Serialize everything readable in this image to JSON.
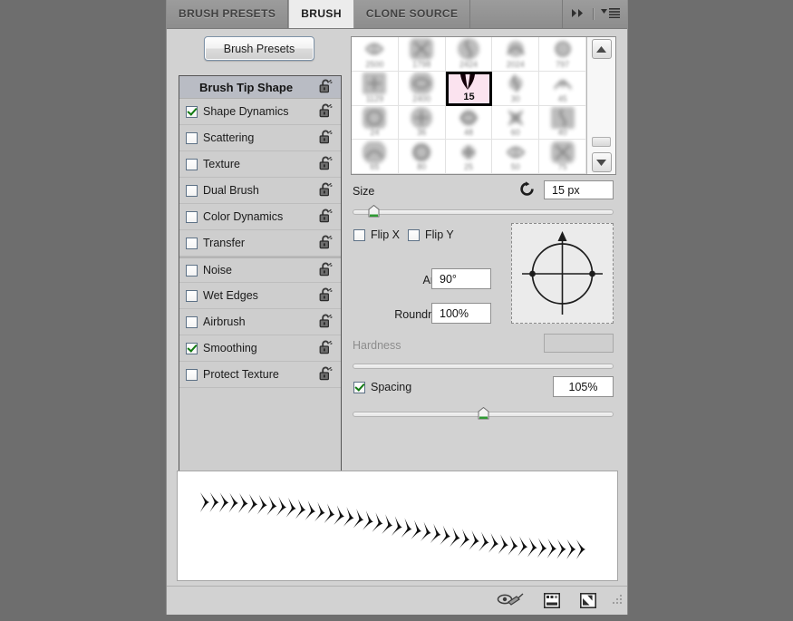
{
  "panel": {
    "title": "Brush",
    "tabs": [
      {
        "label": "BRUSH PRESETS",
        "active": false
      },
      {
        "label": "BRUSH",
        "active": true
      },
      {
        "label": "CLONE SOURCE",
        "active": false
      }
    ],
    "expand_icon": "double-chevron-right-icon",
    "menu_icon": "panel-menu-icon"
  },
  "presets_button": {
    "label": "Brush Presets"
  },
  "options": {
    "header": {
      "label": "Brush Tip Shape",
      "lock_icon": "unlocked-padlock-icon"
    },
    "items": [
      {
        "label": "Shape Dynamics",
        "checked": true,
        "lock_icon": "unlocked-padlock-icon",
        "group_start": false
      },
      {
        "label": "Scattering",
        "checked": false,
        "lock_icon": "unlocked-padlock-icon",
        "group_start": false
      },
      {
        "label": "Texture",
        "checked": false,
        "lock_icon": "unlocked-padlock-icon",
        "group_start": false
      },
      {
        "label": "Dual Brush",
        "checked": false,
        "lock_icon": "unlocked-padlock-icon",
        "group_start": false
      },
      {
        "label": "Color Dynamics",
        "checked": false,
        "lock_icon": "unlocked-padlock-icon",
        "group_start": false
      },
      {
        "label": "Transfer",
        "checked": false,
        "lock_icon": "unlocked-padlock-icon",
        "group_start": false
      },
      {
        "label": "Noise",
        "checked": false,
        "lock_icon": "unlocked-padlock-icon",
        "group_start": true
      },
      {
        "label": "Wet Edges",
        "checked": false,
        "lock_icon": "unlocked-padlock-icon",
        "group_start": false
      },
      {
        "label": "Airbrush",
        "checked": false,
        "lock_icon": "unlocked-padlock-icon",
        "group_start": false
      },
      {
        "label": "Smoothing",
        "checked": true,
        "lock_icon": "unlocked-padlock-icon",
        "group_start": false
      },
      {
        "label": "Protect Texture",
        "checked": false,
        "lock_icon": "unlocked-padlock-icon",
        "group_start": false
      }
    ]
  },
  "thumbnails": {
    "selected_index": 7,
    "selected_label": "15",
    "scroll_up_icon": "chevron-up-icon",
    "scroll_down_icon": "chevron-down-icon",
    "cells": [
      {
        "label": "2500"
      },
      {
        "label": "1798"
      },
      {
        "label": "2424"
      },
      {
        "label": "2024"
      },
      {
        "label": "797"
      },
      {
        "label": "1129"
      },
      {
        "label": "2400"
      },
      {
        "label": "15"
      },
      {
        "label": "30"
      },
      {
        "label": "45"
      },
      {
        "label": "24"
      },
      {
        "label": "36"
      },
      {
        "label": "48"
      },
      {
        "label": "60"
      },
      {
        "label": "40"
      },
      {
        "label": "65"
      },
      {
        "label": "80"
      },
      {
        "label": "25"
      },
      {
        "label": "50"
      },
      {
        "label": "75"
      }
    ]
  },
  "size": {
    "label": "Size",
    "reset_icon": "reset-arrow-icon",
    "value": "15 px",
    "slider_percent": 8
  },
  "flip": {
    "x": {
      "label": "Flip X",
      "checked": false
    },
    "y": {
      "label": "Flip Y",
      "checked": false
    }
  },
  "angle": {
    "label": "Angle:",
    "value": "90°"
  },
  "roundness": {
    "label": "Roundness:",
    "value": "100%"
  },
  "angle_preview": {
    "icon": "angle-roundness-dial",
    "degrees": 90
  },
  "hardness": {
    "label": "Hardness",
    "value": "",
    "disabled": true,
    "slider_percent": 0
  },
  "spacing": {
    "label": "Spacing",
    "checked": true,
    "value": "105%",
    "slider_percent": 50
  },
  "stroke_preview": {
    "name": "brush-stroke-preview"
  },
  "footer": {
    "icons": [
      {
        "name": "toggle-live-tip-brush-icon"
      },
      {
        "name": "open-preset-manager-icon"
      },
      {
        "name": "create-new-brush-icon"
      }
    ],
    "grip": {
      "name": "resize-grip-icon"
    }
  }
}
